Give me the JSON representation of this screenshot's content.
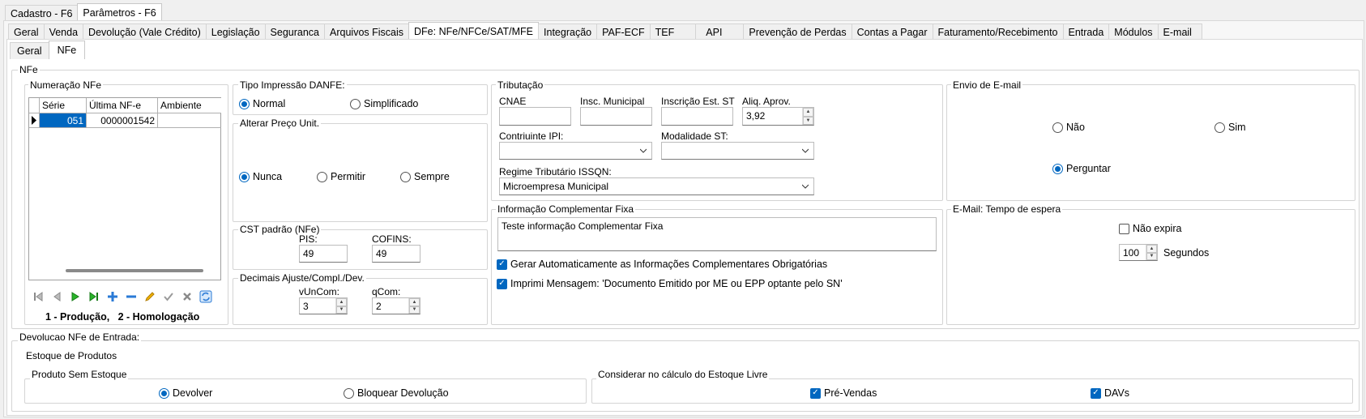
{
  "top_tabs": [
    "Cadastro - F6",
    "Parâmetros - F6"
  ],
  "main_tabs": [
    "Geral",
    "Venda",
    "Devolução (Vale Crédito)",
    "Legislação",
    "Seguranca",
    "Arquivos Fiscais",
    "DFe: NFe/NFCe/SAT/MFE",
    "Integração",
    "PAF-ECF",
    "TEF",
    "API",
    "Prevenção de Perdas",
    "Contas a Pagar",
    "Faturamento/Recebimento",
    "Entrada",
    "Módulos",
    "E-mail"
  ],
  "sub_tabs": [
    "Geral",
    "NFe"
  ],
  "nfe": {
    "title": "NFe",
    "numeracao": {
      "title": "Numeração NFe",
      "columns": [
        "Série",
        "Última NF-e",
        "Ambiente"
      ],
      "rows": [
        {
          "serie": "051",
          "ultima": "0000001542",
          "ambiente": ""
        }
      ],
      "legend": "1 - Produção,   2 - Homologação"
    },
    "danfe": {
      "title": "Tipo Impressão DANFE:",
      "opt_normal": "Normal",
      "opt_simplificado": "Simplificado"
    },
    "preco": {
      "title": "Alterar Preço Unit.",
      "opt_nunca": "Nunca",
      "opt_permitir": "Permitir",
      "opt_sempre": "Sempre"
    },
    "cst": {
      "title": "CST padrão (NFe)",
      "pis_label": "PIS:",
      "pis_value": "49",
      "cofins_label": "COFINS:",
      "cofins_value": "49"
    },
    "decimais": {
      "title": "Decimais Ajuste/Compl./Dev.",
      "vuncom_label": "vUnCom:",
      "vuncom_value": "3",
      "qcom_label": "qCom:",
      "qcom_value": "2"
    },
    "tributacao": {
      "title": "Tributação",
      "cnae_label": "CNAE",
      "cnae_value": "",
      "insc_mun_label": "Insc. Municipal",
      "insc_mun_value": "",
      "insc_st_label": "Inscrição Est. ST",
      "insc_st_value": "",
      "aliq_label": "Aliq. Aprov.",
      "aliq_value": "3,92",
      "contrib_ipi_label": "Contriuinte IPI:",
      "contrib_ipi_value": "",
      "modalidade_label": "Modalidade ST:",
      "modalidade_value": "",
      "regime_label": "Regime Tributário ISSQN:",
      "regime_value": "Microempresa Municipal"
    },
    "info": {
      "title": "Informação Complementar Fixa",
      "text": "Teste informação Complementar Fixa",
      "chk_gerar": "Gerar Automaticamente as Informações Complementares Obrigatórias",
      "chk_imprimi": "Imprimi Mensagem: 'Documento Emitido por ME ou EPP optante pelo SN'"
    },
    "email": {
      "title": "Envio de E-mail",
      "opt_nao": "Não",
      "opt_sim": "Sim",
      "opt_perguntar": "Perguntar"
    },
    "espera": {
      "title": "E-Mail: Tempo de espera",
      "chk_nao_expira": "Não expira",
      "seconds_value": "100",
      "seconds_label": "Segundos"
    }
  },
  "devolucao": {
    "title": "Devolucao NFe de Entrada:",
    "estoque_title": "Estoque de Produtos",
    "sem_estoque_title": "Produto Sem Estoque",
    "opt_devolver": "Devolver",
    "opt_bloquear": "Bloquear Devolução",
    "considerar_title": "Considerar no cálculo do Estoque Livre",
    "chk_prevendas": "Pré-Vendas",
    "chk_davs": "DAVs"
  }
}
